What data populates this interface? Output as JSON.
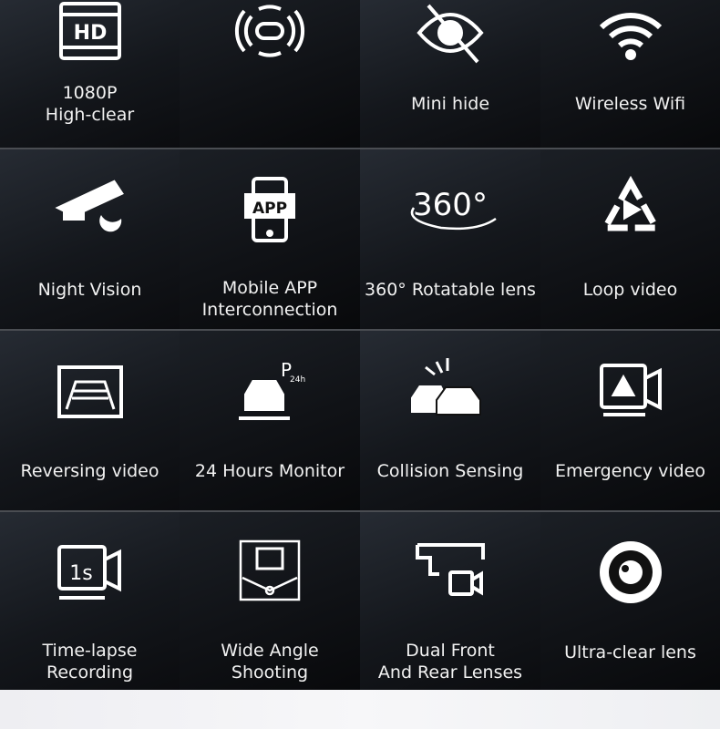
{
  "features": [
    {
      "label": "1080P\nHigh-clear",
      "icon": "hd-film-icon"
    },
    {
      "label": "",
      "icon": "rotate-signal-icon"
    },
    {
      "label": "Mini hide",
      "icon": "eye-hidden-icon"
    },
    {
      "label": "Wireless Wifi",
      "icon": "wifi-icon"
    },
    {
      "label": "Night Vision",
      "icon": "night-camera-icon"
    },
    {
      "label": "Mobile APP\nInterconnection",
      "icon": "mobile-app-icon",
      "icon_text": "APP"
    },
    {
      "label": "360° Rotatable lens",
      "icon": "rotate-360-icon",
      "icon_text": "360°"
    },
    {
      "label": "Loop video",
      "icon": "loop-play-icon"
    },
    {
      "label": "Reversing video",
      "icon": "reversing-guide-icon"
    },
    {
      "label": "24 Hours Monitor",
      "icon": "parking-car-icon",
      "icon_text": "P",
      "icon_sub": "24h"
    },
    {
      "label": "Collision Sensing",
      "icon": "collision-cars-icon"
    },
    {
      "label": "Emergency video",
      "icon": "emergency-camera-icon"
    },
    {
      "label": "Time-lapse\nRecording",
      "icon": "timelapse-camera-icon",
      "icon_text": "1s"
    },
    {
      "label": "Wide Angle\nShooting",
      "icon": "wide-angle-icon"
    },
    {
      "label": "Dual Front\nAnd Rear Lenses",
      "icon": "dual-lens-icon"
    },
    {
      "label": "Ultra-clear lens",
      "icon": "lens-icon"
    }
  ]
}
